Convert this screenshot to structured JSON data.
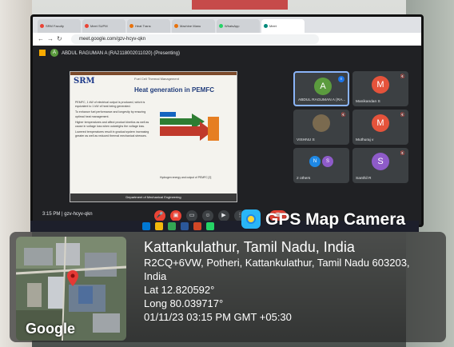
{
  "watermark": {
    "brand_text": "GPS Map Camera",
    "brand_colors": {
      "icon_bg": "#29b6f6",
      "lens": "#fdd835"
    }
  },
  "location": {
    "title": "Kattankulathur, Tamil Nadu, India",
    "address_line1": "R2CQ+6VW, Potheri, Kattankulathur, Tamil Nadu 603203,",
    "address_line2": "India",
    "lat": "Lat 12.820592°",
    "long": "Long 80.039717°",
    "datetime": "01/11/23 03:15 PM GMT +05:30"
  },
  "map": {
    "provider_label": "Google",
    "pin_icon": "map-pin-icon"
  },
  "browser": {
    "tabs": [
      "SRM Faculty",
      "Meet SUPM",
      "Heat Trans",
      "Machine Manu",
      "WhatsApp",
      "Meet"
    ],
    "url": "meet.google.com/gzv-hcyv-qkn"
  },
  "meet": {
    "presenter_label": "ABDUL RAGUMAN A (RA2118002011020) (Presenting)",
    "presenter_initial": "A",
    "time_code": "3:15 PM  |  gzv-hcyv-qkn",
    "participants": [
      {
        "initial": "A",
        "name": "ABDUL RAGUMAN A (RA...",
        "color": "#5b9b3e"
      },
      {
        "initial": "M",
        "name": "Manikandan S",
        "color": "#e5533b"
      },
      {
        "initial": "",
        "name": "VISHNU S",
        "color": "#7a6a4f"
      },
      {
        "initial": "M",
        "name": "Muthuraj v",
        "color": "#e5533b"
      },
      {
        "initial": "",
        "name": "2 others",
        "color": "#3c4043"
      },
      {
        "initial": "S",
        "name": "Santhil R",
        "color": "#8e5bc9"
      }
    ],
    "others_initials": [
      "N",
      "S"
    ]
  },
  "slide": {
    "logo": "SRM",
    "subtitle": "Fuel Cell Thermal Management",
    "title": "Heat generation in PEMFC",
    "bullets": [
      "PEMFC, 1 kW of electrical output is produced, which is equivalent to 1 kW of heat being generated.",
      "To enhance fuel performance and longevity by ensuring optimal heat management.",
      "Higher temperatures and affect product kinetics as well as cause in voltage loss when outweighs the voltage loss.",
      "Lowered temperatures result in gradual system increasing greater as well as reduced thermal mechanical stresses."
    ],
    "caption": "Hydrogen energy and output of PEMFC [2]",
    "footer": "Department of Mechanical Engineering"
  }
}
